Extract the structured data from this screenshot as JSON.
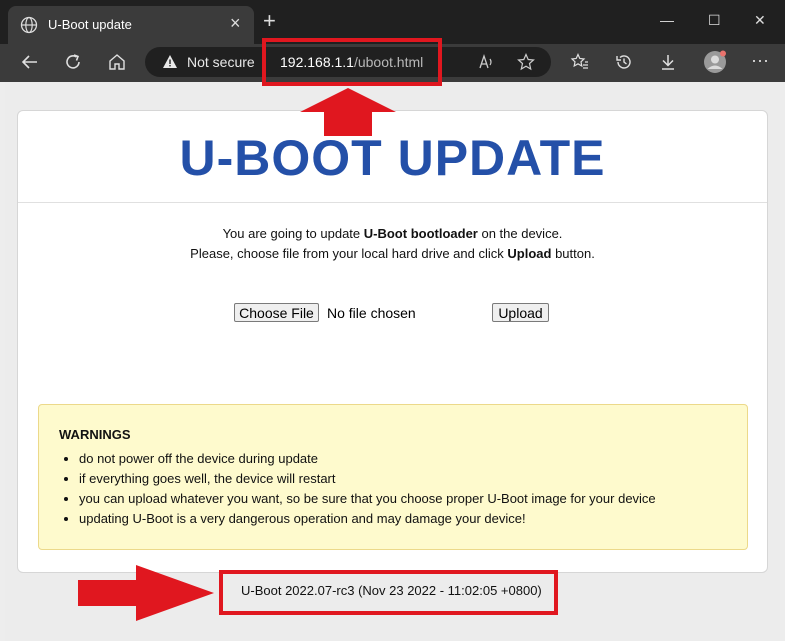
{
  "browser": {
    "tab_title": "U-Boot update",
    "new_tab": "+",
    "not_secure": "Not secure",
    "url_host": "192.168.1.1",
    "url_path": "/uboot.html",
    "window_controls": {
      "minimize": "—",
      "maximize": "☐",
      "close": "✕"
    }
  },
  "page": {
    "heading": "U-BOOT UPDATE",
    "desc_line1_pre": "You are going to update ",
    "desc_line1_bold": "U-Boot bootloader",
    "desc_line1_post": " on the device.",
    "desc_line2_pre": "Please, choose file from your local hard drive and click ",
    "desc_line2_bold": "Upload",
    "desc_line2_post": " button.",
    "choose_file_label": "Choose File",
    "no_file_text": "No file chosen",
    "upload_label": "Upload",
    "warnings_title": "WARNINGS",
    "warnings": [
      "do not power off the device during update",
      "if everything goes well, the device will restart",
      "you can upload whatever you want, so be sure that you choose proper U-Boot image for your device",
      "updating U-Boot is a very dangerous operation and may damage your device!"
    ],
    "footer_version": "U-Boot 2022.07-rc3 (Nov 23 2022 - 11:02:05 +0800)"
  },
  "colors": {
    "heading": "#2450a8",
    "annotation_red": "#e0171f",
    "warning_bg": "#fefacd"
  },
  "icons": [
    "globe-icon",
    "close-icon",
    "back-icon",
    "refresh-icon",
    "home-icon",
    "warning-icon",
    "read-aloud-icon",
    "star-icon",
    "favorites-icon",
    "history-icon",
    "download-icon",
    "avatar",
    "more-icon"
  ]
}
